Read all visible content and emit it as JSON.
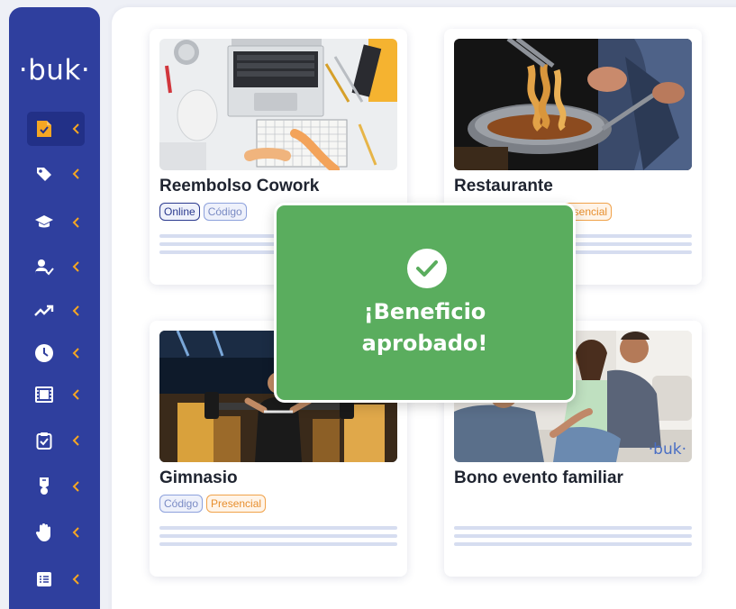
{
  "brand": {
    "logo": "·buk·"
  },
  "sidebar": {
    "items": [
      {
        "icon": "document-check-icon",
        "active": true
      },
      {
        "icon": "tag-icon",
        "active": false
      },
      {
        "icon": "graduation-cap-icon",
        "active": false
      },
      {
        "icon": "user-check-icon",
        "active": false
      },
      {
        "icon": "trending-up-icon",
        "active": false
      },
      {
        "icon": "clock-icon",
        "active": false
      },
      {
        "icon": "film-icon",
        "active": false
      },
      {
        "icon": "clipboard-check-icon",
        "active": false
      },
      {
        "icon": "medal-icon",
        "active": false
      },
      {
        "icon": "hand-icon",
        "active": false
      },
      {
        "icon": "list-icon",
        "active": false
      }
    ]
  },
  "cards": [
    {
      "title": "Reembolso Cowork",
      "tags": [
        "Online",
        "Código"
      ],
      "image": "laptop-desk"
    },
    {
      "title": "Restaurante",
      "tags": [
        "Presencial"
      ],
      "image": "pasta-pan"
    },
    {
      "title": "Gimnasio",
      "tags": [
        "Código",
        "Presencial"
      ],
      "image": "gym"
    },
    {
      "title": "Bono evento familiar",
      "tags": [],
      "image": "family",
      "watermark": "·buk·"
    }
  ],
  "overlay": {
    "line1": "¡Beneficio",
    "line2": "aprobado!",
    "icon": "check-icon"
  },
  "colors": {
    "sidebar": "#2f3f9e",
    "accent": "#f5a623",
    "success": "#5aad5e"
  }
}
